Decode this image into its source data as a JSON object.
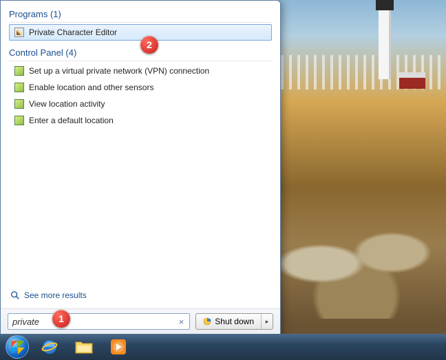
{
  "sections": {
    "programs": {
      "header": "Programs (1)"
    },
    "control_panel": {
      "header": "Control Panel (4)"
    }
  },
  "results": {
    "program_0": "Private Character Editor",
    "cp_0": "Set up a virtual private network (VPN) connection",
    "cp_1": "Enable location and other sensors",
    "cp_2": "View location activity",
    "cp_3": "Enter a default location"
  },
  "see_more": "See more results",
  "search": {
    "value": "private",
    "clear": "×"
  },
  "shutdown": {
    "label": "Shut down",
    "arrow": "▸"
  },
  "annotations": {
    "a1": "1",
    "a2": "2"
  }
}
